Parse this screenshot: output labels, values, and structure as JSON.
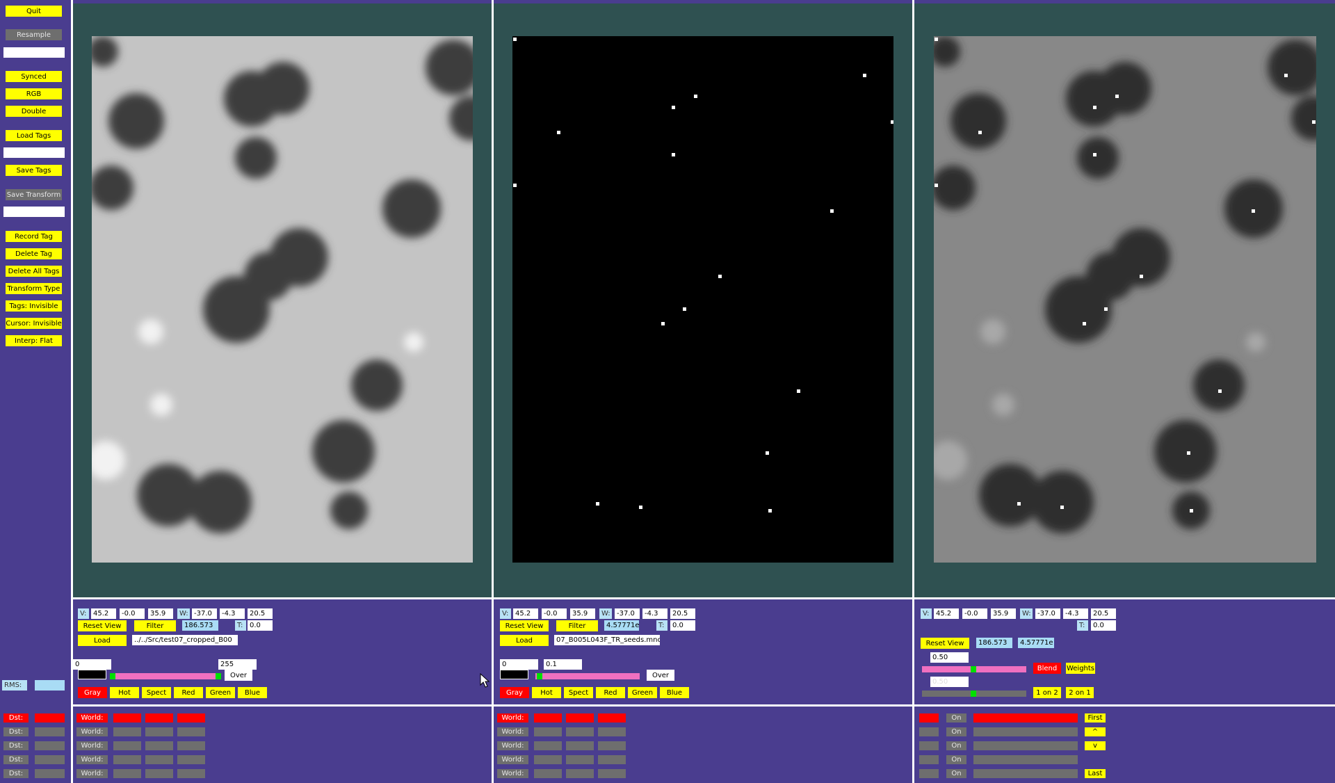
{
  "sidebar": {
    "quit": "Quit",
    "resample": "Resample",
    "synced": "Synced",
    "rgb": "RGB",
    "double": "Double",
    "load_tags": "Load Tags",
    "save_tags": "Save Tags",
    "save_transform": "Save Transform",
    "record_tag": "Record Tag",
    "delete_tag": "Delete Tag",
    "delete_all_tags": "Delete All Tags",
    "transform_type": "Transform Type",
    "tags_invisible": "Tags: Invisible",
    "cursor_invisible": "Cursor: Invisible",
    "interp_flat": "Interp: Flat",
    "rms_label": "RMS:",
    "rms_value": ""
  },
  "colors": {
    "background": "#4a3d8f",
    "panel": "#2f5151",
    "button": "#ffff00",
    "active": "#ff0000"
  },
  "panels": [
    {
      "v_label": "V:",
      "v": [
        "45.2",
        "-0.0",
        "35.9"
      ],
      "w_label": "W:",
      "w": [
        "-37.0",
        "-4.3",
        "20.5"
      ],
      "t_label": "T:",
      "t": "0.0",
      "reset_view": "Reset View",
      "filter": "Filter",
      "filter_value": "186.573",
      "load": "Load",
      "filename": "../../Src/test07_cropped_B00",
      "range_min": "0",
      "range_max": "255",
      "over": "Over",
      "colormaps": [
        "Gray",
        "Hot",
        "Spect",
        "Red",
        "Green",
        "Blue"
      ]
    },
    {
      "v_label": "V:",
      "v": [
        "45.2",
        "-0.0",
        "35.9"
      ],
      "w_label": "W:",
      "w": [
        "-37.0",
        "-4.3",
        "20.5"
      ],
      "t_label": "T:",
      "t": "0.0",
      "reset_view": "Reset View",
      "filter": "Filter",
      "filter_value": "4.57771e",
      "load": "Load",
      "filename": "07_B005L043F_TR_seeds.mnc",
      "range_min": "0",
      "range_max": "0.1",
      "over": "Over",
      "colormaps": [
        "Gray",
        "Hot",
        "Spect",
        "Red",
        "Green",
        "Blue"
      ]
    },
    {
      "v_label": "V:",
      "v": [
        "45.2",
        "-0.0",
        "35.9"
      ],
      "w_label": "W:",
      "w": [
        "-37.0",
        "-4.3",
        "20.5"
      ],
      "t_label": "T:",
      "t": "0.0",
      "reset_view": "Reset View",
      "value_a": "186.573",
      "value_b": "4.57771e",
      "blend_value1": "0.50",
      "blend_value2": "0.50",
      "blend": "Blend",
      "weights": "Weights",
      "one_on_two": "1 on 2",
      "two_on_one": "2 on 1"
    }
  ],
  "tags": {
    "dst_labels": [
      "Dst:",
      "Dst:",
      "Dst:",
      "Dst:",
      "Dst:"
    ],
    "world_labels": [
      "World:",
      "World:",
      "World:",
      "World:",
      "World:"
    ],
    "on_labels": [
      "On",
      "On",
      "On",
      "On",
      "On"
    ],
    "nav": [
      "First",
      "^",
      "v",
      "Last"
    ]
  }
}
